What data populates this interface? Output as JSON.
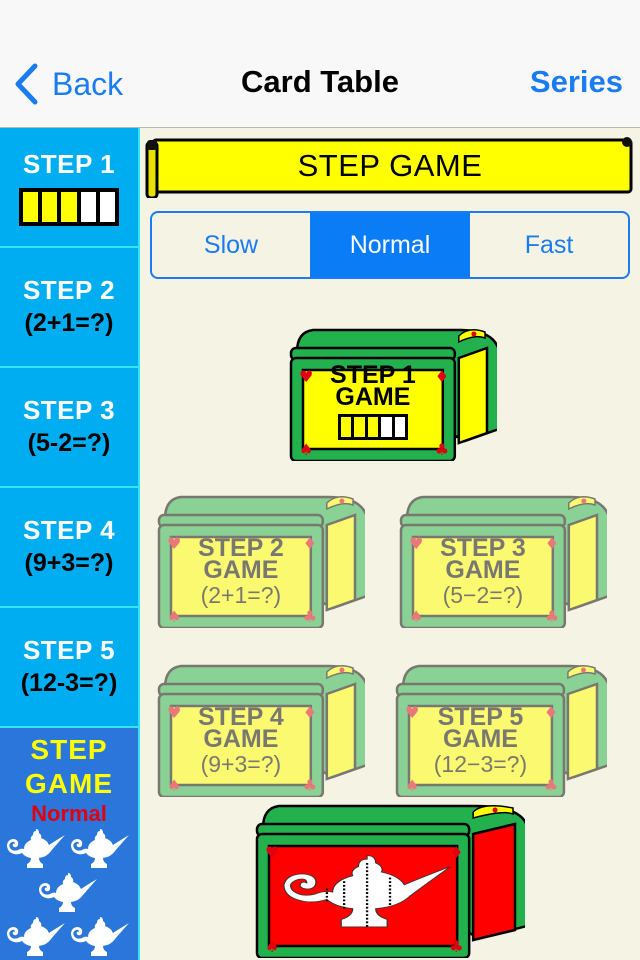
{
  "navbar": {
    "back_label": "Back",
    "title": "Card Table",
    "right_label": "Series",
    "accent_color": "#1a7cf0"
  },
  "sidebar": {
    "items": [
      {
        "title": "STEP 1",
        "subtitle": null,
        "progress": {
          "filled": 3,
          "total": 5
        }
      },
      {
        "title": "STEP 2",
        "subtitle": "(2+1=?)"
      },
      {
        "title": "STEP 3",
        "subtitle": "(5-2=?)"
      },
      {
        "title": "STEP 4",
        "subtitle": "(9+3=?)"
      },
      {
        "title": "STEP 5",
        "subtitle": "(12-3=?)"
      }
    ],
    "game": {
      "line1": "STEP",
      "line2": "GAME",
      "mode": "Normal",
      "icon": "magic-lamp-icon"
    }
  },
  "banner": {
    "title": "STEP GAME"
  },
  "speed": {
    "options": [
      "Slow",
      "Normal",
      "Fast"
    ],
    "selected": "Normal"
  },
  "chests": [
    {
      "line1": "STEP 1",
      "line2": "GAME",
      "line3": null,
      "progress": {
        "filled": 3,
        "total": 5
      },
      "locked": false
    },
    {
      "line1": "STEP 2",
      "line2": "GAME",
      "line3": "(2+1=?)",
      "locked": true
    },
    {
      "line1": "STEP 3",
      "line2": "GAME",
      "line3": "(5−2=?)",
      "locked": true
    },
    {
      "line1": "STEP 4",
      "line2": "GAME",
      "line3": "(9+3=?)",
      "locked": true
    },
    {
      "line1": "STEP 5",
      "line2": "GAME",
      "line3": "(12−3=?)",
      "locked": true
    }
  ],
  "game_chest": {
    "icon": "magic-lamp-icon",
    "locked": false
  }
}
